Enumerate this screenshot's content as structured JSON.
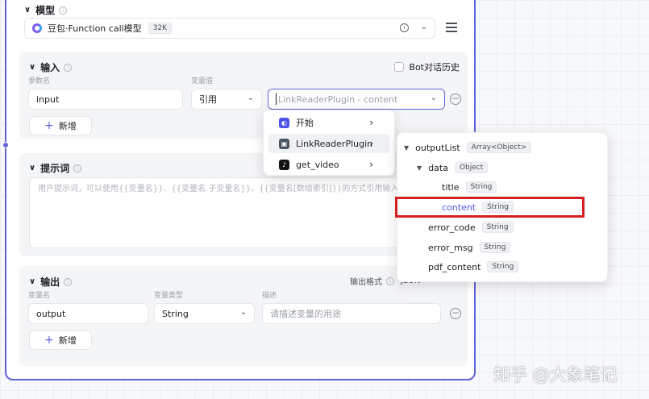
{
  "model": {
    "section_title": "模型",
    "selected_model": "豆包·Function call模型",
    "context_badge": "32K"
  },
  "input": {
    "section_title": "输入",
    "bot_history_label": "Bot对话历史",
    "col_param_name": "参数名",
    "col_var_value": "变量值",
    "param_name_value": "input",
    "ref_type_value": "引用",
    "ref_value": "LinkReaderPlugin - content",
    "add_label": "新增"
  },
  "prompt": {
    "section_title": "提示词",
    "placeholder": "用户提示词，可以使用{{变量名}}、{{变量名.子变量名}}、{{变量名[数组索引]}}的方式引用输入参数中的变量"
  },
  "output": {
    "section_title": "输出",
    "format_label": "输出格式",
    "format_value": "JSON",
    "col_var_name": "变量名",
    "col_var_type": "变量类型",
    "col_desc": "描述",
    "var_name_value": "output",
    "var_type_value": "String",
    "desc_placeholder": "请描述变量的用途",
    "add_label": "新增"
  },
  "source_menu": {
    "items": [
      {
        "label": "开始",
        "icon": "start-icon"
      },
      {
        "label": "LinkReaderPlugin",
        "icon": "plugin-icon"
      },
      {
        "label": "get_video",
        "icon": "tiktok-icon"
      }
    ]
  },
  "field_tree": {
    "rows": [
      {
        "label": "outputList",
        "type": "Array<Object>"
      },
      {
        "label": "data",
        "type": "Object"
      },
      {
        "label": "title",
        "type": "String"
      },
      {
        "label": "content",
        "type": "String",
        "selected": true
      },
      {
        "label": "error_code",
        "type": "String"
      },
      {
        "label": "error_msg",
        "type": "String"
      },
      {
        "label": "pdf_content",
        "type": "String"
      }
    ]
  },
  "watermark": "知乎 @大象笔记",
  "colors": {
    "accent": "#5e63d6",
    "selected_text": "#4d53e8",
    "highlight_border": "#d71f1f"
  }
}
